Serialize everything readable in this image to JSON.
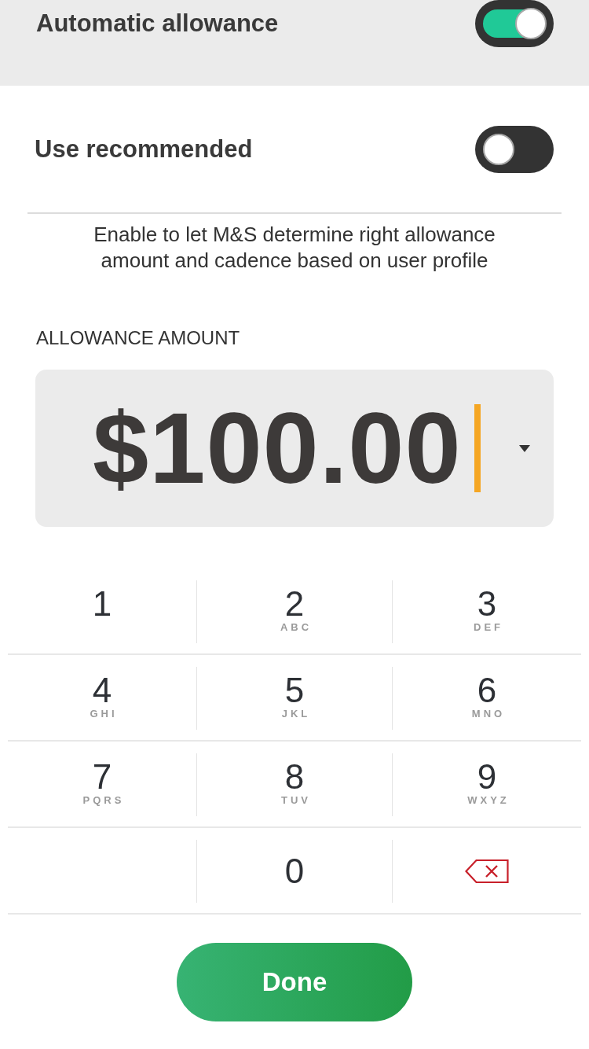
{
  "header": {
    "label": "Automatic allowance",
    "on": true
  },
  "recommended": {
    "label": "Use recommended",
    "on": false,
    "description": "Enable to let M&S determine right allowance amount and cadence based on user profile"
  },
  "amount": {
    "label": "ALLOWANCE AMOUNT",
    "value": "$100.00"
  },
  "keypad": [
    {
      "kind": "digit",
      "digit": "1"
    },
    {
      "kind": "digit",
      "digit": "2",
      "letters": "ABC"
    },
    {
      "kind": "digit",
      "digit": "3",
      "letters": "DEF"
    },
    {
      "kind": "digit",
      "digit": "4",
      "letters": "GHI"
    },
    {
      "kind": "digit",
      "digit": "5",
      "letters": "JKL"
    },
    {
      "kind": "digit",
      "digit": "6",
      "letters": "MNO"
    },
    {
      "kind": "digit",
      "digit": "7",
      "letters": "PQRS"
    },
    {
      "kind": "digit",
      "digit": "8",
      "letters": "TUV"
    },
    {
      "kind": "digit",
      "digit": "9",
      "letters": "WXYZ"
    },
    {
      "kind": "digit",
      "digit": "0"
    },
    {
      "kind": "delete"
    }
  ],
  "done_button": {
    "label": "Done"
  }
}
